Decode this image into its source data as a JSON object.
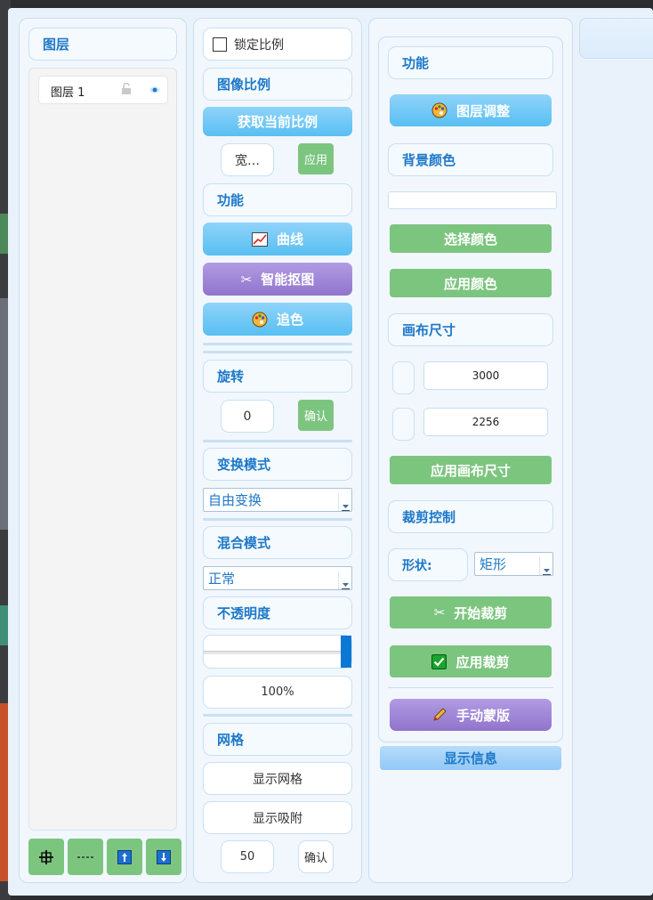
{
  "layers": {
    "title": "图层",
    "items": [
      {
        "name": "图层 1"
      }
    ],
    "bottom_buttons": [
      "add-layer",
      "remove-layer",
      "move-layer-up",
      "move-layer-down"
    ]
  },
  "col2": {
    "lock_ratio": "锁定比例",
    "image_ratio": "图像比例",
    "get_ratio": "获取当前比例",
    "width_btn": "宽…",
    "apply_ratio_btn": "应用",
    "func_title": "功能",
    "curves": "曲线",
    "smart_cutout": "智能抠图",
    "color_chase": "追色",
    "rotate_title": "旋转",
    "rotate_value": "0",
    "rotate_confirm": "确认",
    "transform_title": "变换模式",
    "transform_value": "自由变换",
    "blend_title": "混合模式",
    "blend_value": "正常",
    "opacity_title": "不透明度",
    "opacity_fraction": 1.0,
    "opacity_value": "100%",
    "grid_title": "网格",
    "show_grid": "显示网格",
    "show_snap": "显示吸附",
    "grid_size": "50",
    "grid_apply": "确认"
  },
  "col3": {
    "func_title": "功能",
    "layer_adjust": "图层调整",
    "bg_color_title": "背景颜色",
    "choose_color": "选择颜色",
    "apply_color": "应用颜色",
    "canvas_size_title": "画布尺寸",
    "canvas_width": "3000",
    "canvas_height": "2256",
    "apply_canvas": "应用画布尺寸",
    "crop_title": "裁剪控制",
    "shape_label": "形状:",
    "shape_value": "矩形",
    "start_crop": "开始裁剪",
    "apply_crop": "应用裁剪",
    "manual_mask": "手动蒙版",
    "show_info": "显示信息"
  },
  "colors": {
    "accent_blue": "#1d78c8",
    "button_blue": "#58bff2",
    "button_purple": "#9074cc",
    "button_green": "#7cc57f",
    "slider_handle": "#0a78d4"
  }
}
